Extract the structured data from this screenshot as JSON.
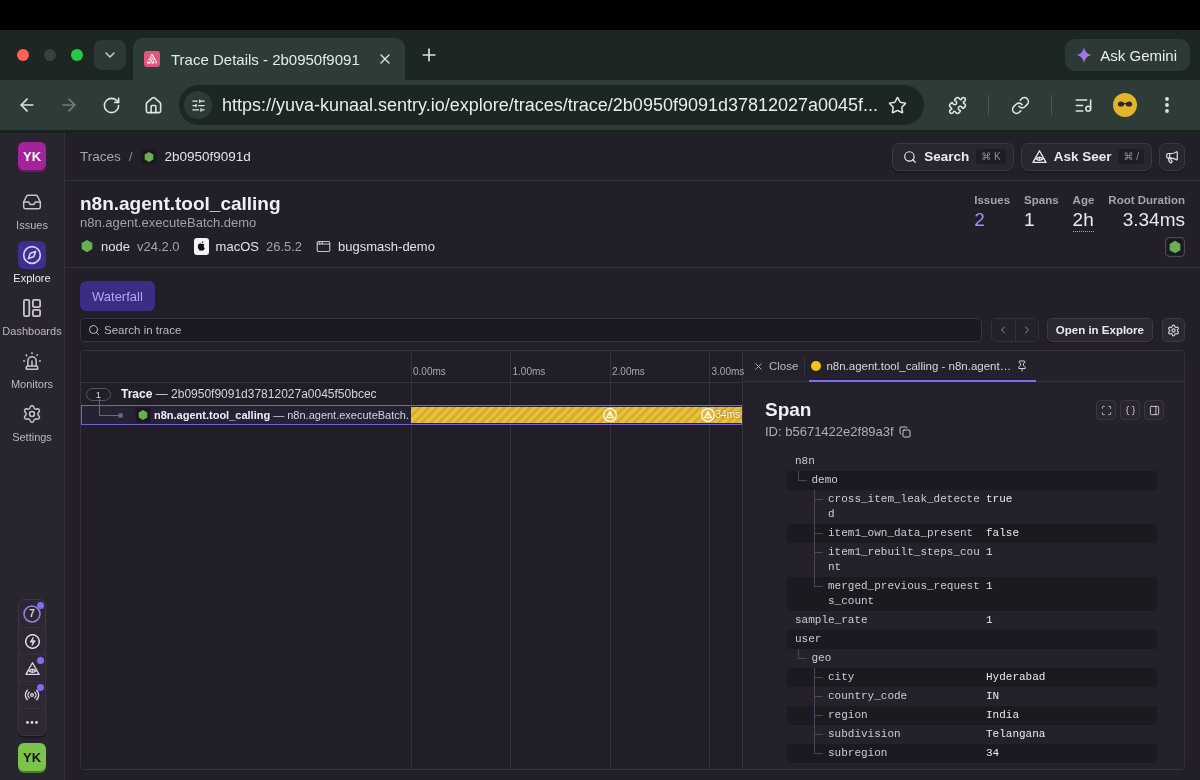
{
  "browser": {
    "tabs": [
      {
        "title": "Trace Details - 2b0950f9091",
        "selected": true
      }
    ],
    "gemini_button": "Ask Gemini",
    "nav": {
      "back_disabled": false,
      "forward_disabled": true
    },
    "url": "https://yuva-kunaal.sentry.io/explore/traces/trace/2b0950f9091d37812027a0045f..."
  },
  "sidebar": {
    "org_avatar": "YK",
    "items": [
      {
        "label": "Issues",
        "selected": false
      },
      {
        "label": "Explore",
        "selected": true
      },
      {
        "label": "Dashboards",
        "selected": false
      },
      {
        "label": "Monitors",
        "selected": false
      },
      {
        "label": "Settings",
        "selected": false
      }
    ],
    "tools": [
      {
        "kind": "ring",
        "count": "7",
        "unread": true
      },
      {
        "kind": "icon",
        "unread": false
      },
      {
        "kind": "icon",
        "unread": true
      },
      {
        "kind": "icon",
        "unread": true
      },
      {
        "kind": "more",
        "unread": false
      }
    ],
    "user_avatar": "YK"
  },
  "header": {
    "breadcrumb": [
      {
        "label": "Traces",
        "kind": "link"
      },
      {
        "label": "2b0950f9091d",
        "kind": "trace"
      }
    ],
    "separator": "/",
    "search_button": {
      "label": "Search",
      "shortcut": "⌘ K"
    },
    "seer_button": {
      "label": "Ask Seer",
      "shortcut": "⌘ /"
    }
  },
  "trace": {
    "title": "n8n.agent.tool_calling",
    "subtitle": "n8n.agent.executeBatch.demo",
    "tags": [
      {
        "kind": "node",
        "name": "node",
        "version": "v24.2.0"
      },
      {
        "kind": "os",
        "name": "macOS",
        "version": "26.5.2"
      },
      {
        "kind": "browser",
        "name": "bugsmash-demo"
      }
    ],
    "stats": [
      {
        "label": "Issues",
        "value": "2",
        "kind": "link"
      },
      {
        "label": "Spans",
        "value": "1",
        "kind": "plain"
      },
      {
        "label": "Age",
        "value": "2h",
        "kind": "tooltip"
      },
      {
        "label": "Root Duration",
        "value": "3.34ms",
        "kind": "plain"
      }
    ]
  },
  "view_tabs": [
    {
      "label": "Waterfall",
      "selected": true
    }
  ],
  "trace_search": {
    "placeholder": "Search in trace"
  },
  "open_in_explore": "Open in Explore",
  "waterfall": {
    "ticks": [
      "0.00ms",
      "1.00ms",
      "2.00ms",
      "3.00ms"
    ],
    "rows": [
      {
        "kind": "trace",
        "count": "1",
        "text": "**Trace** — 2b0950f9091d37812027a0045f50bcec",
        "selected": false
      },
      {
        "kind": "span",
        "text": "**n8n.agent.tool_calling** — n8n.agent.executeBatch.",
        "duration": "34ms",
        "selected": true
      }
    ]
  },
  "drawer": {
    "close": "Close",
    "tabs": [
      {
        "title": "n8n.agent.tool_calling - n8n.agent…",
        "selected": true
      }
    ],
    "title": "Span",
    "id": "ID: b5671422e2f89a3f",
    "attributes": [
      {
        "key": "n8n",
        "children": [
          {
            "key": "demo",
            "children": [
              {
                "key": "cross_item_leak_detected",
                "value": "true"
              },
              {
                "key": "item1_own_data_present",
                "value": "false"
              },
              {
                "key": "item1_rebuilt_steps_count",
                "value": "1"
              },
              {
                "key": "merged_previous_requests_count",
                "value": "1"
              }
            ]
          }
        ]
      },
      {
        "key": "sample_rate",
        "value": "1"
      },
      {
        "key": "user",
        "children": [
          {
            "key": "geo",
            "children": [
              {
                "key": "city",
                "value": "Hyderabad"
              },
              {
                "key": "country_code",
                "value": "IN"
              },
              {
                "key": "region",
                "value": "India"
              },
              {
                "key": "subdivision",
                "value": "Telangana"
              },
              {
                "key": "subregion",
                "value": "34"
              }
            ]
          }
        ]
      }
    ]
  }
}
